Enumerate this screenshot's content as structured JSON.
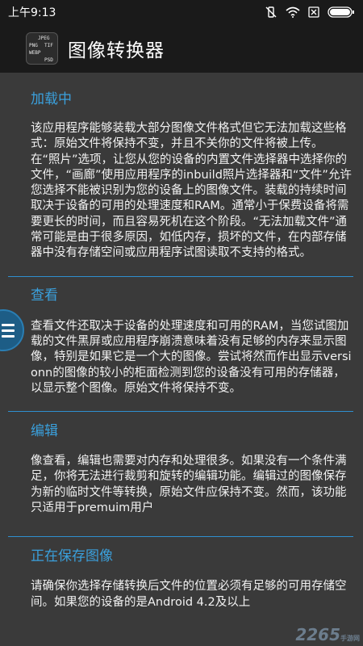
{
  "status_bar": {
    "time": "上午9:13",
    "battery_icon": "battery-icon",
    "wifi_icon": "wifi-icon",
    "mute_icon": "vibrate-off-icon",
    "sim_icon": "no-sim-icon"
  },
  "app_bar": {
    "title": "图像转换器",
    "icon_labels": [
      "JPEG",
      "PNG",
      "TIF",
      "WEBP",
      "PSD"
    ]
  },
  "sections": [
    {
      "title": "加载中",
      "body": "该应用程序能够装载大部分图像文件格式但它无法加载这些格式：原始文件将保持不变，并且不关你的文件将被上传。在“照片”选项，让您从您的设备的内置文件选择器中选择你的文件，“画廊”使用应用程序的inbuild照片选择器和“文件”允许您选择不能被识别为您的设备上的图像文件。装载的持续时间取决于设备的可用的处理速度和RAM。通常小于保费设备将需要更长的时间，而且容易死机在这个阶段。“无法加载文件”通常可能是由于很多原因，如低内存，损坏的文件，在内部存储器中没有存储空间或应用程序试图读取不支持的格式。"
    },
    {
      "title": "查看",
      "body": "查看文件还取决于设备的处理速度和可用的RAM，当您试图加载的文件黑屏或应用程序崩溃意味着没有足够的内存来显示图像，特别是如果它是一个大的图像。尝试将然而作出显示versionn的图像的较小的柜面检测到您的设备没有可用的存储器，以显示整个图像。原始文件将保持不变。"
    },
    {
      "title": "编辑",
      "body": "像查看，编辑也需要对内存和处理很多。如果没有一个条件满足，你将无法进行裁剪和旋转的编辑功能。编辑过的图像保存为新的临时文件等转换，原始文件应保持不变。然而，该功能只适用于premuim用户"
    },
    {
      "title": "正在保存图像",
      "body": "请确保你选择存储转换后文件的位置必须有足够的可用存储空间。如果您的设备的是Android 4.2及以上"
    }
  ],
  "fab": {
    "icon": "menu-icon"
  },
  "watermark": {
    "text": "2265",
    "sub": "手游网"
  }
}
